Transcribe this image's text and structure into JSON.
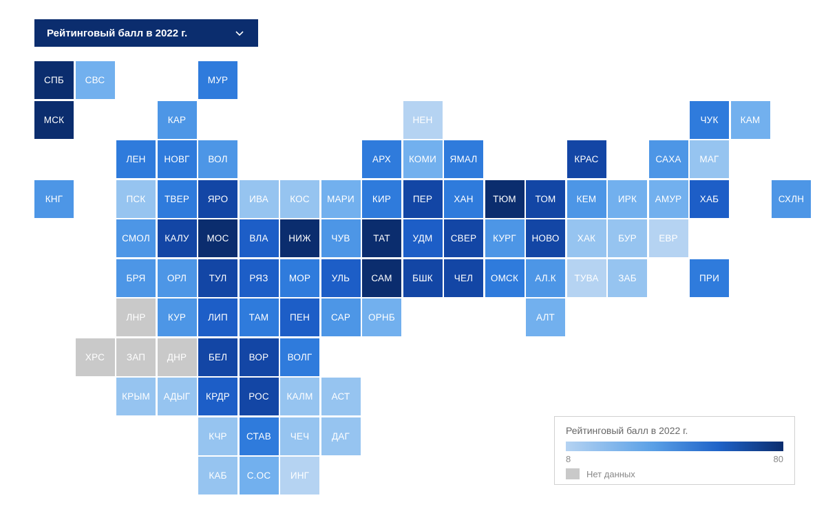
{
  "dropdown": {
    "label": "Рейтинговый балл в 2022 г."
  },
  "legend": {
    "title": "Рейтинговый балл в 2022 г.",
    "min": "8",
    "max": "80",
    "nodata": "Нет данных"
  },
  "colors": {
    "1": "#b5d3f2",
    "2": "#96c4f0",
    "3": "#72b0ee",
    "4": "#4d96e6",
    "5": "#2f7bdc",
    "6": "#1d5ec7",
    "7": "#1346a5",
    "8": "#0b2d6e",
    "nd": "#c9c9c9"
  },
  "cells": [
    {
      "code": "СПБ",
      "row": 1,
      "col": 1,
      "lvl": "8"
    },
    {
      "code": "СВС",
      "row": 1,
      "col": 2,
      "lvl": "3"
    },
    {
      "code": "МУР",
      "row": 1,
      "col": 5,
      "lvl": "5"
    },
    {
      "code": "МСК",
      "row": 2,
      "col": 1,
      "lvl": "8"
    },
    {
      "code": "КАР",
      "row": 2,
      "col": 4,
      "lvl": "4"
    },
    {
      "code": "НЕН",
      "row": 2,
      "col": 10,
      "lvl": "1"
    },
    {
      "code": "ЧУК",
      "row": 2,
      "col": 17,
      "lvl": "5"
    },
    {
      "code": "КАМ",
      "row": 2,
      "col": 18,
      "lvl": "3"
    },
    {
      "code": "ЛЕН",
      "row": 3,
      "col": 3,
      "lvl": "5"
    },
    {
      "code": "НОВГ",
      "row": 3,
      "col": 4,
      "lvl": "5"
    },
    {
      "code": "ВОЛ",
      "row": 3,
      "col": 5,
      "lvl": "4"
    },
    {
      "code": "АРХ",
      "row": 3,
      "col": 9,
      "lvl": "5"
    },
    {
      "code": "КОМИ",
      "row": 3,
      "col": 10,
      "lvl": "3"
    },
    {
      "code": "ЯМАЛ",
      "row": 3,
      "col": 11,
      "lvl": "5"
    },
    {
      "code": "КРАС",
      "row": 3,
      "col": 14,
      "lvl": "7"
    },
    {
      "code": "САХА",
      "row": 3,
      "col": 16,
      "lvl": "4"
    },
    {
      "code": "МАГ",
      "row": 3,
      "col": 17,
      "lvl": "2"
    },
    {
      "code": "КНГ",
      "row": 4,
      "col": 1,
      "lvl": "4"
    },
    {
      "code": "ПСК",
      "row": 4,
      "col": 3,
      "lvl": "2"
    },
    {
      "code": "ТВЕР",
      "row": 4,
      "col": 4,
      "lvl": "5"
    },
    {
      "code": "ЯРО",
      "row": 4,
      "col": 5,
      "lvl": "7"
    },
    {
      "code": "ИВА",
      "row": 4,
      "col": 6,
      "lvl": "2"
    },
    {
      "code": "КОС",
      "row": 4,
      "col": 7,
      "lvl": "2"
    },
    {
      "code": "МАРИ",
      "row": 4,
      "col": 8,
      "lvl": "3"
    },
    {
      "code": "КИР",
      "row": 4,
      "col": 9,
      "lvl": "5"
    },
    {
      "code": "ПЕР",
      "row": 4,
      "col": 10,
      "lvl": "7"
    },
    {
      "code": "ХАН",
      "row": 4,
      "col": 11,
      "lvl": "5"
    },
    {
      "code": "ТЮМ",
      "row": 4,
      "col": 12,
      "lvl": "8"
    },
    {
      "code": "ТОМ",
      "row": 4,
      "col": 13,
      "lvl": "7"
    },
    {
      "code": "КЕМ",
      "row": 4,
      "col": 14,
      "lvl": "4"
    },
    {
      "code": "ИРК",
      "row": 4,
      "col": 15,
      "lvl": "3"
    },
    {
      "code": "АМУР",
      "row": 4,
      "col": 16,
      "lvl": "3"
    },
    {
      "code": "ХАБ",
      "row": 4,
      "col": 17,
      "lvl": "6"
    },
    {
      "code": "СХЛН",
      "row": 4,
      "col": 19,
      "lvl": "4"
    },
    {
      "code": "СМОЛ",
      "row": 5,
      "col": 3,
      "lvl": "4"
    },
    {
      "code": "КАЛУ",
      "row": 5,
      "col": 4,
      "lvl": "7"
    },
    {
      "code": "МОС",
      "row": 5,
      "col": 5,
      "lvl": "8"
    },
    {
      "code": "ВЛА",
      "row": 5,
      "col": 6,
      "lvl": "6"
    },
    {
      "code": "НИЖ",
      "row": 5,
      "col": 7,
      "lvl": "8"
    },
    {
      "code": "ЧУВ",
      "row": 5,
      "col": 8,
      "lvl": "4"
    },
    {
      "code": "ТАТ",
      "row": 5,
      "col": 9,
      "lvl": "8"
    },
    {
      "code": "УДМ",
      "row": 5,
      "col": 10,
      "lvl": "6"
    },
    {
      "code": "СВЕР",
      "row": 5,
      "col": 11,
      "lvl": "7"
    },
    {
      "code": "КУРГ",
      "row": 5,
      "col": 12,
      "lvl": "4"
    },
    {
      "code": "НОВО",
      "row": 5,
      "col": 13,
      "lvl": "7"
    },
    {
      "code": "ХАК",
      "row": 5,
      "col": 14,
      "lvl": "2"
    },
    {
      "code": "БУР",
      "row": 5,
      "col": 15,
      "lvl": "2"
    },
    {
      "code": "ЕВР",
      "row": 5,
      "col": 16,
      "lvl": "1"
    },
    {
      "code": "БРЯ",
      "row": 6,
      "col": 3,
      "lvl": "4"
    },
    {
      "code": "ОРЛ",
      "row": 6,
      "col": 4,
      "lvl": "4"
    },
    {
      "code": "ТУЛ",
      "row": 6,
      "col": 5,
      "lvl": "7"
    },
    {
      "code": "РЯЗ",
      "row": 6,
      "col": 6,
      "lvl": "6"
    },
    {
      "code": "МОР",
      "row": 6,
      "col": 7,
      "lvl": "5"
    },
    {
      "code": "УЛЬ",
      "row": 6,
      "col": 8,
      "lvl": "6"
    },
    {
      "code": "САМ",
      "row": 6,
      "col": 9,
      "lvl": "8"
    },
    {
      "code": "БШК",
      "row": 6,
      "col": 10,
      "lvl": "7"
    },
    {
      "code": "ЧЕЛ",
      "row": 6,
      "col": 11,
      "lvl": "7"
    },
    {
      "code": "ОМСК",
      "row": 6,
      "col": 12,
      "lvl": "5"
    },
    {
      "code": "АЛ.К",
      "row": 6,
      "col": 13,
      "lvl": "4"
    },
    {
      "code": "ТУВА",
      "row": 6,
      "col": 14,
      "lvl": "1"
    },
    {
      "code": "ЗАБ",
      "row": 6,
      "col": 15,
      "lvl": "2"
    },
    {
      "code": "ПРИ",
      "row": 6,
      "col": 17,
      "lvl": "5"
    },
    {
      "code": "ЛНР",
      "row": 7,
      "col": 3,
      "lvl": "nd"
    },
    {
      "code": "КУР",
      "row": 7,
      "col": 4,
      "lvl": "4"
    },
    {
      "code": "ЛИП",
      "row": 7,
      "col": 5,
      "lvl": "6"
    },
    {
      "code": "ТАМ",
      "row": 7,
      "col": 6,
      "lvl": "5"
    },
    {
      "code": "ПЕН",
      "row": 7,
      "col": 7,
      "lvl": "6"
    },
    {
      "code": "САР",
      "row": 7,
      "col": 8,
      "lvl": "4"
    },
    {
      "code": "ОРНБ",
      "row": 7,
      "col": 9,
      "lvl": "3"
    },
    {
      "code": "АЛТ",
      "row": 7,
      "col": 13,
      "lvl": "3"
    },
    {
      "code": "ХРС",
      "row": 8,
      "col": 2,
      "lvl": "nd"
    },
    {
      "code": "ЗАП",
      "row": 8,
      "col": 3,
      "lvl": "nd"
    },
    {
      "code": "ДНР",
      "row": 8,
      "col": 4,
      "lvl": "nd"
    },
    {
      "code": "БЕЛ",
      "row": 8,
      "col": 5,
      "lvl": "7"
    },
    {
      "code": "ВОР",
      "row": 8,
      "col": 6,
      "lvl": "7"
    },
    {
      "code": "ВОЛГ",
      "row": 8,
      "col": 7,
      "lvl": "5"
    },
    {
      "code": "КРЫМ",
      "row": 9,
      "col": 3,
      "lvl": "2"
    },
    {
      "code": "АДЫГ",
      "row": 9,
      "col": 4,
      "lvl": "2"
    },
    {
      "code": "КРДР",
      "row": 9,
      "col": 5,
      "lvl": "6"
    },
    {
      "code": "РОС",
      "row": 9,
      "col": 6,
      "lvl": "7"
    },
    {
      "code": "КАЛМ",
      "row": 9,
      "col": 7,
      "lvl": "2"
    },
    {
      "code": "АСТ",
      "row": 9,
      "col": 8,
      "lvl": "2"
    },
    {
      "code": "КЧР",
      "row": 10,
      "col": 5,
      "lvl": "2"
    },
    {
      "code": "СТАВ",
      "row": 10,
      "col": 6,
      "lvl": "5"
    },
    {
      "code": "ЧЕЧ",
      "row": 10,
      "col": 7,
      "lvl": "2"
    },
    {
      "code": "ДАГ",
      "row": 10,
      "col": 8,
      "lvl": "2"
    },
    {
      "code": "КАБ",
      "row": 11,
      "col": 5,
      "lvl": "2"
    },
    {
      "code": "С.ОС",
      "row": 11,
      "col": 6,
      "lvl": "3"
    },
    {
      "code": "ИНГ",
      "row": 11,
      "col": 7,
      "lvl": "1"
    }
  ]
}
